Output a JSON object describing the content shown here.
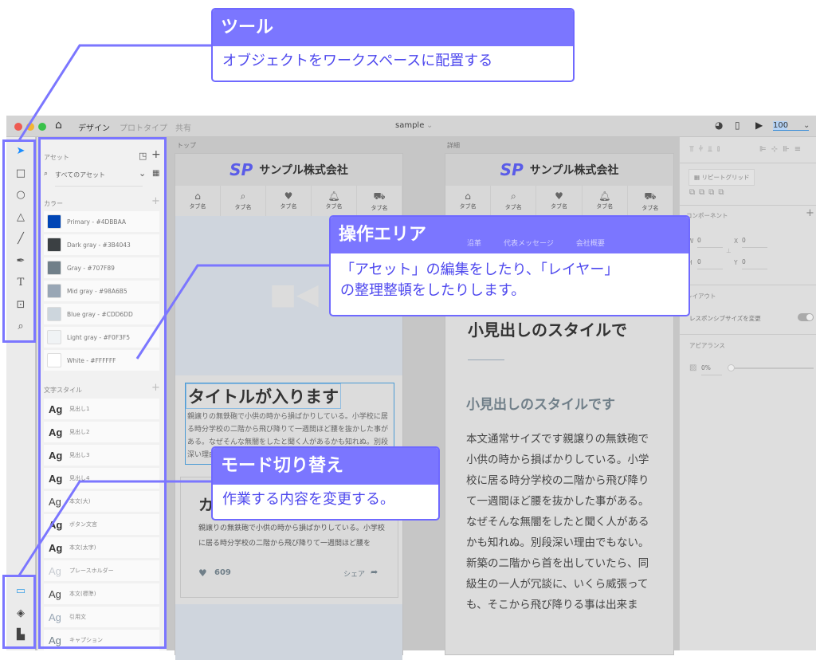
{
  "titlebar": {
    "tabs": [
      "デザイン",
      "プロトタイプ",
      "共有"
    ],
    "document_title": "sample",
    "zoom": "100",
    "icons": [
      "home-icon",
      "share-user-icon",
      "mobile-preview-icon",
      "play-icon"
    ]
  },
  "tools": [
    "select",
    "rectangle",
    "ellipse",
    "polygon",
    "line",
    "pen",
    "text",
    "artboard",
    "zoom"
  ],
  "modes": [
    "assets",
    "layers",
    "plugins"
  ],
  "assets": {
    "title": "アセット",
    "search_placeholder": "すべてのアセット",
    "colors_label": "カラー",
    "colors": [
      {
        "label": "Primary - #4DBBAA",
        "hex": "#0045b5"
      },
      {
        "label": "Dark gray - #3B4043",
        "hex": "#3b4043"
      },
      {
        "label": "Gray - #707F89",
        "hex": "#707f89"
      },
      {
        "label": "Mid gray - #98A6B5",
        "hex": "#98a6b5"
      },
      {
        "label": "Blue gray - #CDD6DD",
        "hex": "#cdd6dd"
      },
      {
        "label": "Light gray - #F0F3F5",
        "hex": "#f0f3f5"
      },
      {
        "label": "White - #FFFFFF",
        "hex": "#ffffff"
      }
    ],
    "text_styles_label": "文字スタイル",
    "text_styles": [
      {
        "sample": "Ag",
        "name": "見出し1",
        "weight": "bold",
        "color": "#333"
      },
      {
        "sample": "Ag",
        "name": "見出し2",
        "weight": "bold",
        "color": "#333"
      },
      {
        "sample": "Ag",
        "name": "見出し3",
        "weight": "bold",
        "color": "#333"
      },
      {
        "sample": "Ag",
        "name": "見出し4",
        "weight": "bold",
        "color": "#333"
      },
      {
        "sample": "Ag",
        "name": "本文(大)",
        "weight": "normal",
        "color": "#444"
      },
      {
        "sample": "Ag",
        "name": "ボタン文言",
        "weight": "bold",
        "color": "#333"
      },
      {
        "sample": "Ag",
        "name": "本文(太字)",
        "weight": "bold",
        "color": "#333"
      },
      {
        "sample": "Ag",
        "name": "プレースホルダー",
        "weight": "normal",
        "color": "#c8ccd2"
      },
      {
        "sample": "Ag",
        "name": "本文(標準)",
        "weight": "normal",
        "color": "#444"
      },
      {
        "sample": "Ag",
        "name": "引用文",
        "weight": "normal",
        "color": "#98a6b5"
      },
      {
        "sample": "Ag",
        "name": "キャプション",
        "weight": "normal",
        "color": "#707f89"
      }
    ]
  },
  "artboard_top": {
    "label": "トップ",
    "logo": "SP",
    "company": "サンプル株式会社",
    "tabs": [
      {
        "icon": "home-icon",
        "label": "タブ名"
      },
      {
        "icon": "search-icon",
        "label": "タブ名"
      },
      {
        "icon": "heart-icon",
        "label": "タブ名"
      },
      {
        "icon": "bell-icon",
        "label": "タブ名"
      },
      {
        "icon": "cart-icon",
        "label": "タブ名"
      }
    ],
    "title": "タイトルが入ります",
    "lead": "親譲りの無鉄砲で小供の時から損ばかりしている。小学校に居る時分学校の二階から飛び降りて一週間ほど腰を抜かした事がある。なぜそんな無闇をしたと聞く人があるかも知れぬ。別段深い理由",
    "card_heading": "カ",
    "card_text": "親譲りの無鉄砲で小供の時から損ばかりしている。小学校に居る時分学校の二階から飛び降りて一週間ほど腰を",
    "likes": "609",
    "share": "シェア"
  },
  "artboard_detail": {
    "label": "詳細",
    "logo": "SP",
    "company": "サンプル株式会社",
    "tabs": [
      {
        "icon": "home-icon",
        "label": "タブ名"
      },
      {
        "icon": "search-icon",
        "label": "タブ名"
      },
      {
        "icon": "heart-icon",
        "label": "タブ名"
      },
      {
        "icon": "bell-icon",
        "label": "タブ名"
      },
      {
        "icon": "cart-icon",
        "label": "タブ名"
      }
    ],
    "subnav": [
      "沿革",
      "代表メッセージ",
      "会社概要"
    ],
    "heading": "小見出しのスタイルで",
    "subheading": "小見出しのスタイルです",
    "body_lines": [
      "本文通常サイズです親譲りの無鉄砲で",
      "小供の時から損ばかりしている。小学",
      "校に居る時分学校の二階から飛び降り",
      "て一週間ほど腰を抜かした事がある。",
      "なぜそんな無闇をしたと聞く人がある",
      "かも知れぬ。別段深い理由でもない。",
      "新築の二階から首を出していたら、同",
      "級生の一人が冗談に、いくら威張って",
      "も、そこから飛び降りる事は出来ま"
    ]
  },
  "inspector": {
    "repeat_grid": "リピートグリッド",
    "component_label": "コンポーネント",
    "w_label": "W",
    "w": "0",
    "h_label": "H",
    "h": "0",
    "x_label": "X",
    "x": "0",
    "y_label": "Y",
    "y": "0",
    "layout_label": "レイアウト",
    "responsive_label": "レスポンシブサイズを変更",
    "responsive_on": true,
    "appearance_label": "アピアランス",
    "opacity": "0%"
  },
  "annotations": {
    "tools": {
      "title": "ツール",
      "body": "オブジェクトをワークスペースに配置する"
    },
    "operation": {
      "title": "操作エリア",
      "body_lines": [
        "「アセット」の編集をしたり、「レイヤー」",
        "の整理整頓をしたりします。"
      ]
    },
    "mode": {
      "title": "モード切り替え",
      "body": "作業する内容を変更する。"
    }
  },
  "colors": {
    "annotation": "#7b76ff",
    "annotation_text": "#4e48ee",
    "select_tool": "#1a8cff"
  }
}
